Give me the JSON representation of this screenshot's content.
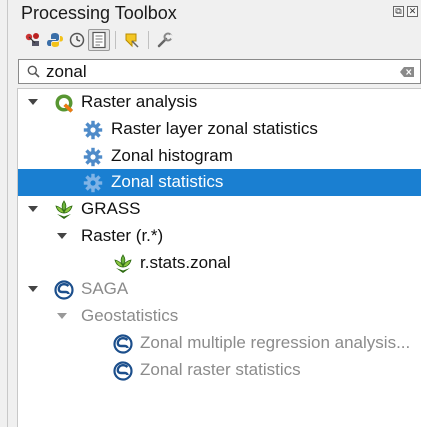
{
  "panel": {
    "title": "Processing Toolbox",
    "window_buttons": [
      "⧉",
      "✕"
    ]
  },
  "toolbar": {
    "icons": [
      "models-icon",
      "python-scripts-icon",
      "history-icon",
      "results-viewer-icon",
      "edit-features-in-place-icon",
      "options-icon"
    ]
  },
  "search": {
    "value": "zonal",
    "placeholder": ""
  },
  "tree": {
    "items": [
      {
        "label": "Raster analysis",
        "icon": "qgis-icon",
        "expanded": true,
        "level": 0
      },
      {
        "label": "Raster layer zonal statistics",
        "icon": "gear-icon",
        "level": 1
      },
      {
        "label": "Zonal histogram",
        "icon": "gear-icon",
        "level": 1
      },
      {
        "label": "Zonal statistics",
        "icon": "gear-icon",
        "level": 1,
        "selected": true
      },
      {
        "label": "GRASS",
        "icon": "grass-icon",
        "expanded": true,
        "level": 0
      },
      {
        "label": "Raster (r.*)",
        "expanded": true,
        "level": 1
      },
      {
        "label": "r.stats.zonal",
        "icon": "grass-icon",
        "level": 2
      },
      {
        "label": "SAGA",
        "icon": "saga-icon",
        "expanded": true,
        "level": 0,
        "disabled": true
      },
      {
        "label": "Geostatistics",
        "expanded": true,
        "level": 1,
        "disabled": true
      },
      {
        "label": "Zonal multiple regression analysis...",
        "icon": "saga-icon",
        "level": 2,
        "disabled": true
      },
      {
        "label": "Zonal raster statistics",
        "icon": "saga-icon",
        "level": 2,
        "disabled": true
      }
    ]
  },
  "colors": {
    "selection": "#1a7fd1",
    "disabled_text": "#8b8b8b",
    "qgis_green": "#589632",
    "saga_blue": "#1c4f8c"
  }
}
